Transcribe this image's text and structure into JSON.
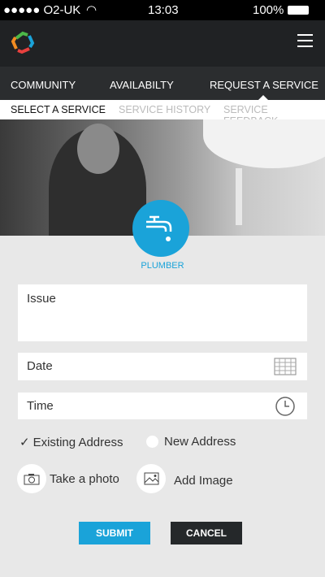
{
  "status_bar": {
    "carrier": "●●●●● O2-UK",
    "time": "13:03",
    "battery": "100%"
  },
  "nav": {
    "tabs": [
      {
        "label": "COMMUNITY"
      },
      {
        "label": "AVAILABILTY"
      },
      {
        "label": "REQUEST A SERVICE",
        "active": true
      }
    ]
  },
  "subnav": {
    "tabs": [
      {
        "label": "SELECT A SERVICE",
        "active": true
      },
      {
        "label": "SERVICE HISTORY"
      },
      {
        "label": "SERVICE FEEDBACK"
      }
    ]
  },
  "service": {
    "label": "PLUMBER",
    "icon": "faucet-icon",
    "color": "#1aa3d9"
  },
  "form": {
    "issue_placeholder": "Issue",
    "date_placeholder": "Date",
    "time_placeholder": "Time",
    "existing_address": "Existing Address",
    "existing_checked": true,
    "new_address": "New Address",
    "take_photo": "Take a photo",
    "add_image": "Add Image"
  },
  "buttons": {
    "submit": "SUBMIT",
    "cancel": "CANCEL",
    "submit_color": "#1aa3d9",
    "cancel_color": "#25282a"
  }
}
